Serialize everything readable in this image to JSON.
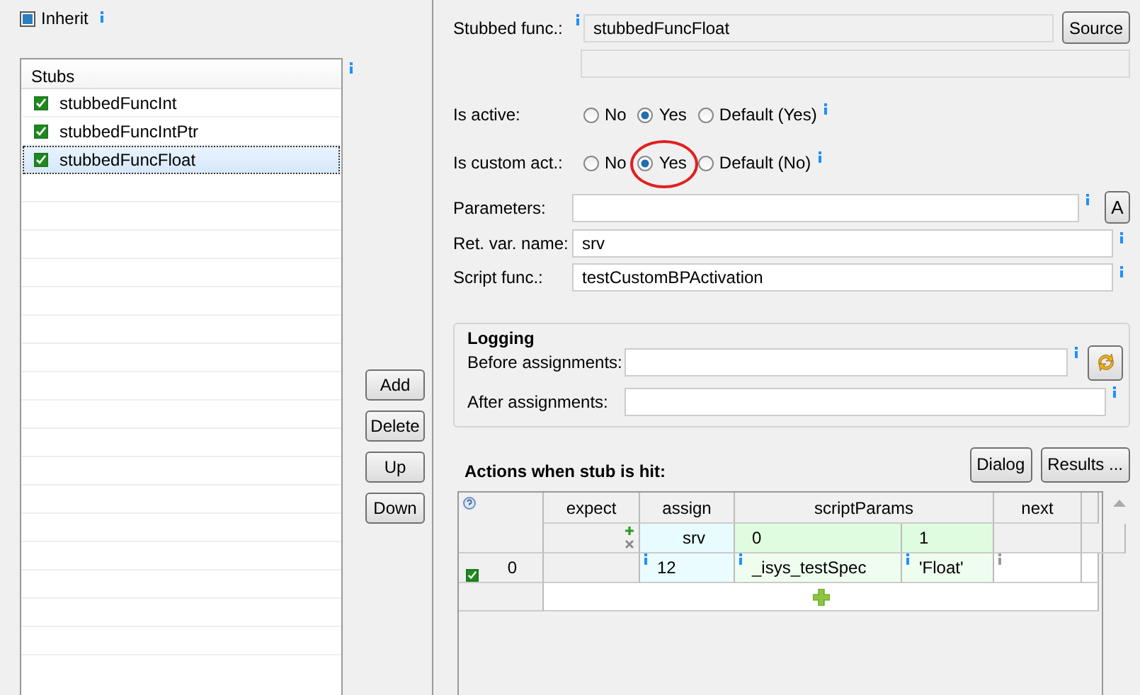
{
  "inherit": {
    "label": "Inherit",
    "checked": true
  },
  "stubs": {
    "header": "Stubs",
    "items": [
      {
        "label": "stubbedFuncInt",
        "checked": true,
        "selected": false
      },
      {
        "label": "stubbedFuncIntPtr",
        "checked": true,
        "selected": false
      },
      {
        "label": "stubbedFuncFloat",
        "checked": true,
        "selected": true
      }
    ]
  },
  "side_buttons": [
    "Add",
    "Delete",
    "Up",
    "Down"
  ],
  "form": {
    "stubbed_func": {
      "label": "Stubbed func.:",
      "value": "stubbedFuncFloat",
      "button": "Source"
    },
    "is_active": {
      "label": "Is active:",
      "options": [
        {
          "label": "No",
          "selected": false,
          "circled": false
        },
        {
          "label": "Yes",
          "selected": true,
          "circled": false
        },
        {
          "label": "Default (Yes)",
          "selected": false,
          "circled": false
        }
      ]
    },
    "is_custom_act": {
      "label": "Is custom act.:",
      "options": [
        {
          "label": "No",
          "selected": false,
          "circled": false
        },
        {
          "label": "Yes",
          "selected": true,
          "circled": true
        },
        {
          "label": "Default (No)",
          "selected": false,
          "circled": false
        }
      ]
    },
    "parameters": {
      "label": "Parameters:",
      "button": "A"
    },
    "ret_var_name": {
      "label": "Ret. var. name:",
      "value": "srv"
    },
    "script_func": {
      "label": "Script func.:",
      "value": "testCustomBPActivation"
    }
  },
  "logging": {
    "title": "Logging",
    "before": {
      "label": "Before assignments:"
    },
    "after": {
      "label": "After assignments:"
    }
  },
  "actions": {
    "title": "Actions when stub is hit:",
    "buttons": [
      "Dialog",
      "Results ..."
    ],
    "table": {
      "columns": [
        "expect",
        "assign",
        "scriptParams",
        "next"
      ],
      "subheaders": [
        "srv",
        "0",
        "1"
      ],
      "rows": [
        {
          "number": "0",
          "checked": true,
          "cells": [
            "",
            "12",
            "_isys_testSpec",
            "'Float'",
            ""
          ]
        }
      ]
    }
  }
}
